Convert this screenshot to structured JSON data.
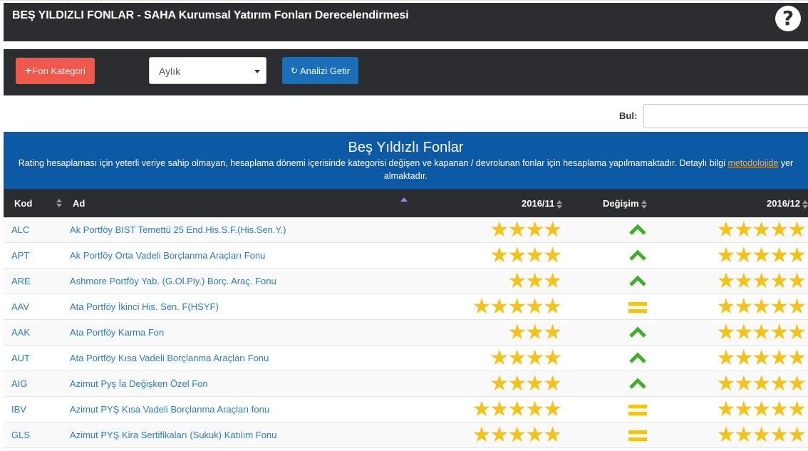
{
  "header": {
    "title": "BEŞ YILDIZLI FONLAR - SAHA Kurumsal Yatırım Fonları Derecelendirmesi",
    "help_icon": "question-circle-icon",
    "help_symbol": "?"
  },
  "toolbar": {
    "kategori_plus": "+",
    "kategori_label": "Fon Kategori",
    "period_selected": "Aylık",
    "refresh_symbol": "↻",
    "analiz_label": "Analizi Getir"
  },
  "search": {
    "label": "Bul:",
    "value": ""
  },
  "panel": {
    "heading": "Beş Yıldızlı Fonlar",
    "description_before": "Rating hesaplaması için yeterli veriye sahip olmayan, hesaplama dönemi içerisinde kategorisi değişen ve kapanan / devrolunan fonlar için hesaplama yapılmamaktadır. Detaylı bilgi ",
    "link_text": "metodolojide",
    "description_after": " yer almaktadır."
  },
  "table": {
    "columns": {
      "kod": "Kod",
      "ad": "Ad",
      "period1": "2016/11",
      "change": "Değişim",
      "period2": "2016/12"
    },
    "rows": [
      {
        "kod": "ALC",
        "ad": "Ak Portföy BIST Temettü 25 End.His.S.F.(His.Sen.Y.)",
        "stars1": 4,
        "change": "up",
        "stars2": 5
      },
      {
        "kod": "APT",
        "ad": "Ak Portföy Orta Vadeli Borçlanma Araçları Fonu",
        "stars1": 4,
        "change": "up",
        "stars2": 5
      },
      {
        "kod": "ARE",
        "ad": "Ashmore Portföy Yab. (G.Ol.Piy.) Borç. Araç. Fonu",
        "stars1": 3,
        "change": "up",
        "stars2": 5
      },
      {
        "kod": "AAV",
        "ad": "Ata Portföy İkinci His. Sen. F(HSYF)",
        "stars1": 5,
        "change": "same",
        "stars2": 5
      },
      {
        "kod": "AAK",
        "ad": "Ata Portföy Karma Fon",
        "stars1": 3,
        "change": "up",
        "stars2": 5
      },
      {
        "kod": "AUT",
        "ad": "Ata Portföy Kısa Vadeli Borçlanma Araçları Fonu",
        "stars1": 4,
        "change": "up",
        "stars2": 5
      },
      {
        "kod": "AIG",
        "ad": "Azimut Pyş İa Değişken Özel Fon",
        "stars1": 4,
        "change": "up",
        "stars2": 5
      },
      {
        "kod": "IBV",
        "ad": "Azimut PYŞ Kısa Vadeli Borçlanma Araçları fonu",
        "stars1": 5,
        "change": "same",
        "stars2": 5
      },
      {
        "kod": "GLS",
        "ad": "Azimut PYŞ Kira Sertifikaları (Sukuk) Katılım Fonu",
        "stars1": 5,
        "change": "same",
        "stars2": 5
      }
    ]
  },
  "colors": {
    "dark_bar": "#2b2d30",
    "panel_blue": "#0c5aa6",
    "kategori_red": "#f0584b",
    "analiz_blue": "#1a6fb8",
    "star": "#f5c316",
    "up_arrow": "#3fae2a",
    "link": "#337ab7"
  }
}
